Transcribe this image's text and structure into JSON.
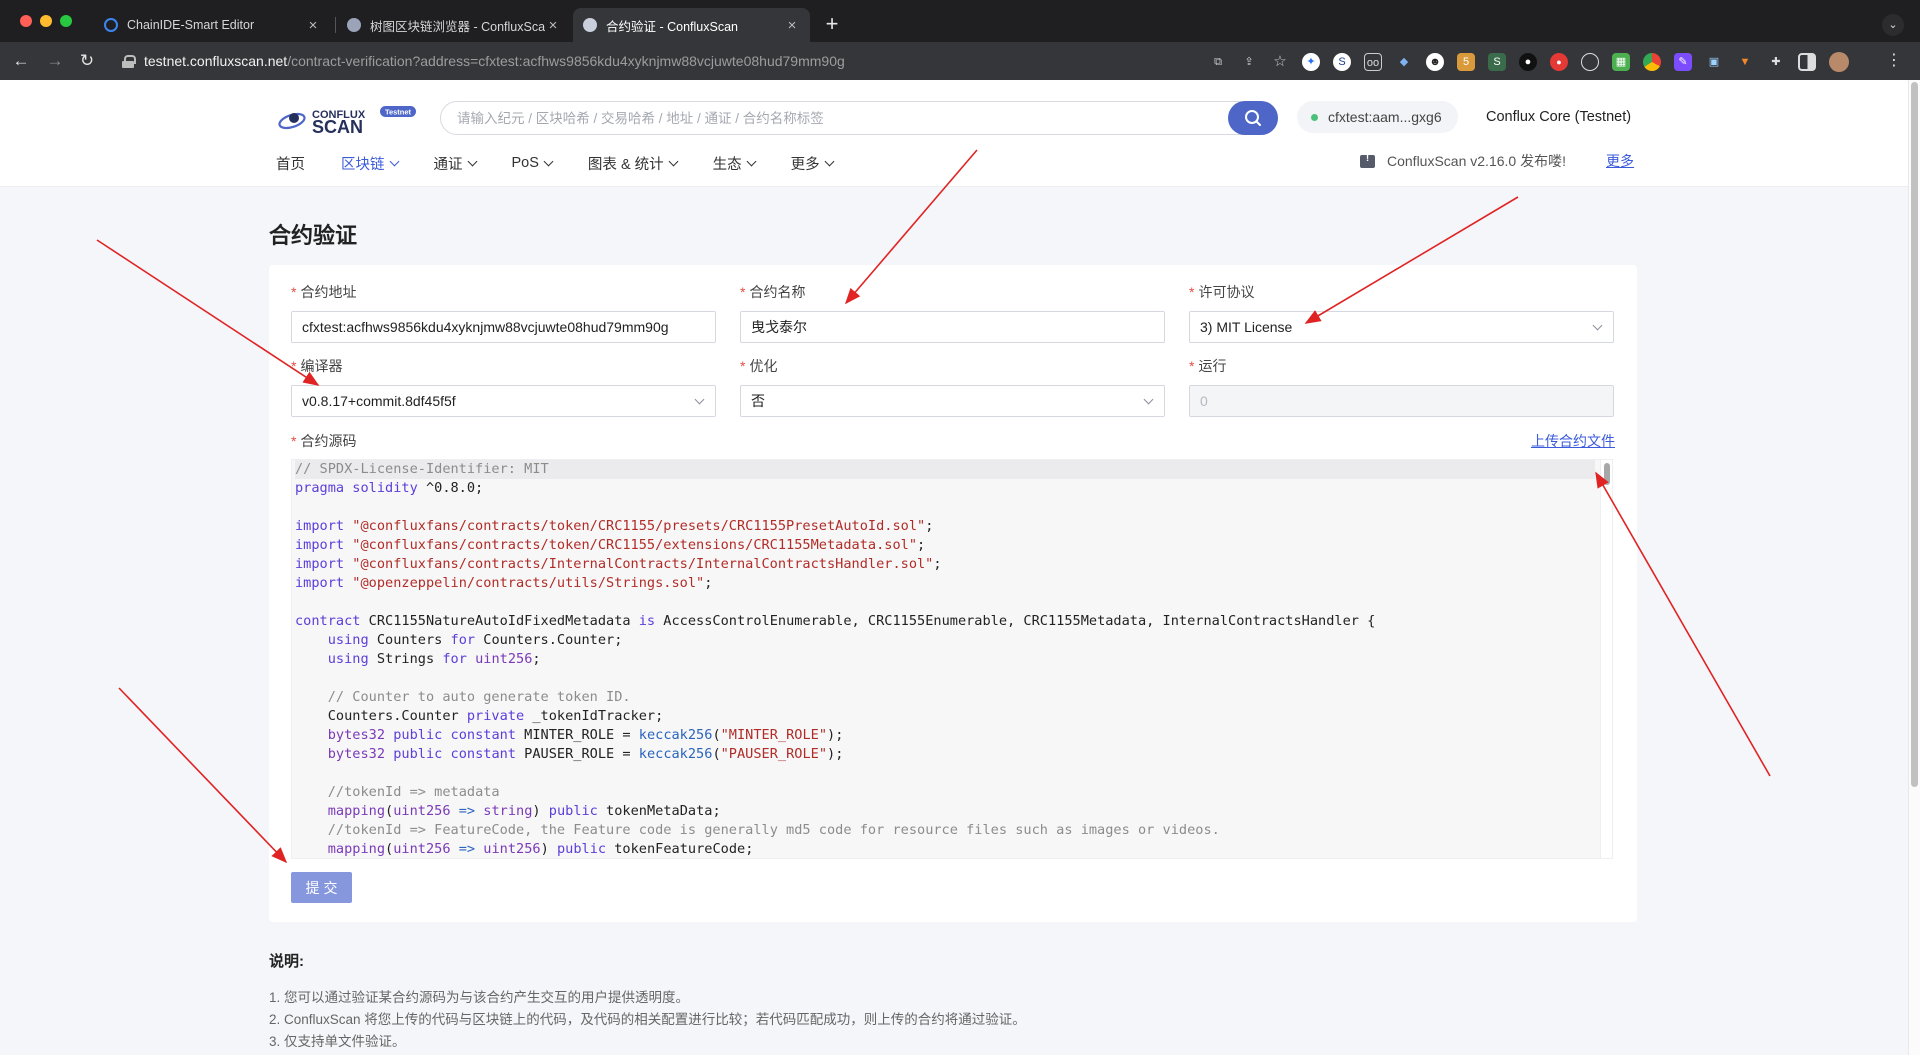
{
  "browser": {
    "tabs": [
      {
        "title": "ChainIDE-Smart Editor"
      },
      {
        "title": "树图区块链浏览器 - ConfluxScan"
      },
      {
        "title": "合约验证 - ConfluxScan"
      }
    ],
    "new_tab": "+",
    "url_host": "testnet.confluxscan.net",
    "url_path": "/contract-verification?address=cfxtest:acfhws9856kdu4xyknjmw88vcjuwte08hud79mm90g",
    "extensions": [
      "translate-icon",
      "share-icon",
      "star-icon",
      "ext-bird-icon",
      "ext-sync-icon",
      "ext-oo-icon",
      "ext-shield-icon",
      "ext-mask-icon",
      "ext-badge-icon",
      "ext-s-icon",
      "ext-dark-icon",
      "ext-red-icon",
      "ext-circle-icon",
      "ext-grid-icon",
      "ext-chrome-icon",
      "ext-pen-icon",
      "ext-square-icon",
      "ext-fox-icon",
      "puzzle-icon",
      "sidepanel-icon",
      "avatar"
    ]
  },
  "header": {
    "logo_badge": "Testnet",
    "search_placeholder": "请输入纪元 / 区块哈希 / 交易哈希 / 地址 / 通证 / 合约名称标签",
    "wallet": "cfxtest:aam...gxg6",
    "network": "Conflux Core (Testnet)",
    "nav": [
      {
        "label": "首页"
      },
      {
        "label": "区块链"
      },
      {
        "label": "通证"
      },
      {
        "label": "PoS"
      },
      {
        "label": "图表 & 统计"
      },
      {
        "label": "生态"
      },
      {
        "label": "更多"
      }
    ],
    "notice": "ConfluxScan v2.16.0 发布喽!",
    "notice_more": "更多"
  },
  "form": {
    "page_title": "合约验证",
    "required_mark": "*",
    "address": {
      "label": "合约地址",
      "value": "cfxtest:acfhws9856kdu4xyknjmw88vcjuwte08hud79mm90g"
    },
    "name": {
      "label": "合约名称",
      "value": "曳戈泰尔"
    },
    "license": {
      "label": "许可协议",
      "value": "3) MIT License"
    },
    "compiler": {
      "label": "编译器",
      "value": "v0.8.17+commit.8df45f5f"
    },
    "optimize": {
      "label": "优化",
      "value": "否"
    },
    "runs": {
      "label": "运行",
      "value": "0"
    },
    "source": {
      "label": "合约源码",
      "upload": "上传合约文件"
    },
    "submit": "提交"
  },
  "notes": {
    "title": "说明:",
    "items": [
      "1. 您可以通过验证某合约源码为与该合约产生交互的用户提供透明度。",
      "2. ConfluxScan 将您上传的代码与区块链上的代码，及代码的相关配置进行比较；若代码匹配成功，则上传的合约将通过验证。",
      "3. 仅支持单文件验证。"
    ]
  },
  "colors": {
    "accent": "#3b5bdb",
    "search_button": "#4d66c8",
    "submit_button": "#8797de",
    "required": "#e54d42",
    "online": "#4bc07a",
    "annotation_arrow": "#e02424"
  }
}
